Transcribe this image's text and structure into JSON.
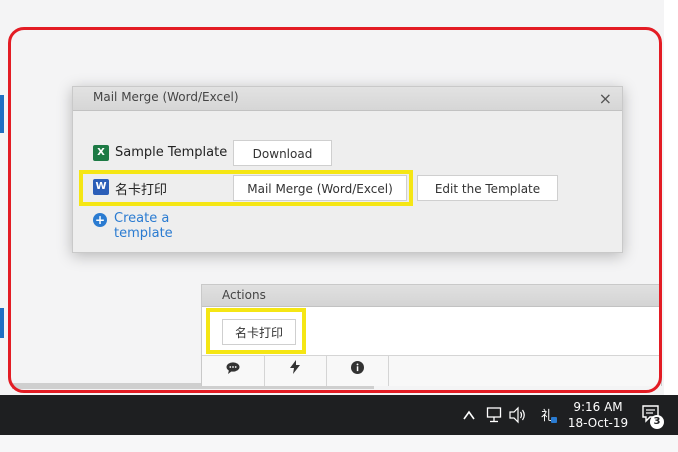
{
  "dialog": {
    "title": "Mail Merge (Word/Excel)",
    "close_glyph": "×",
    "sample": {
      "label": "Sample Template",
      "icon": "excel-icon",
      "button": "Download"
    },
    "merge": {
      "label": "名卡打印",
      "icon": "word-icon",
      "merge_button": "Mail Merge (Word/Excel)",
      "edit_button": "Edit the Template"
    },
    "create_link": "Create a template"
  },
  "actions": {
    "title": "Actions",
    "button": "名卡打印",
    "toolbar": [
      "comment-icon",
      "lightning-icon",
      "info-icon"
    ]
  },
  "taskbar": {
    "time": "9:16 AM",
    "date": "18-Oct-19",
    "notification_count": "3",
    "tray_icons": [
      "chevron-up-icon",
      "network-icon",
      "speaker-icon",
      "input-method-icon",
      "notifications-icon"
    ]
  },
  "colors": {
    "highlight_red": "#e31c24",
    "highlight_yellow": "#f5e614",
    "link_blue": "#2a7bd1",
    "taskbar": "#1e1f21"
  }
}
